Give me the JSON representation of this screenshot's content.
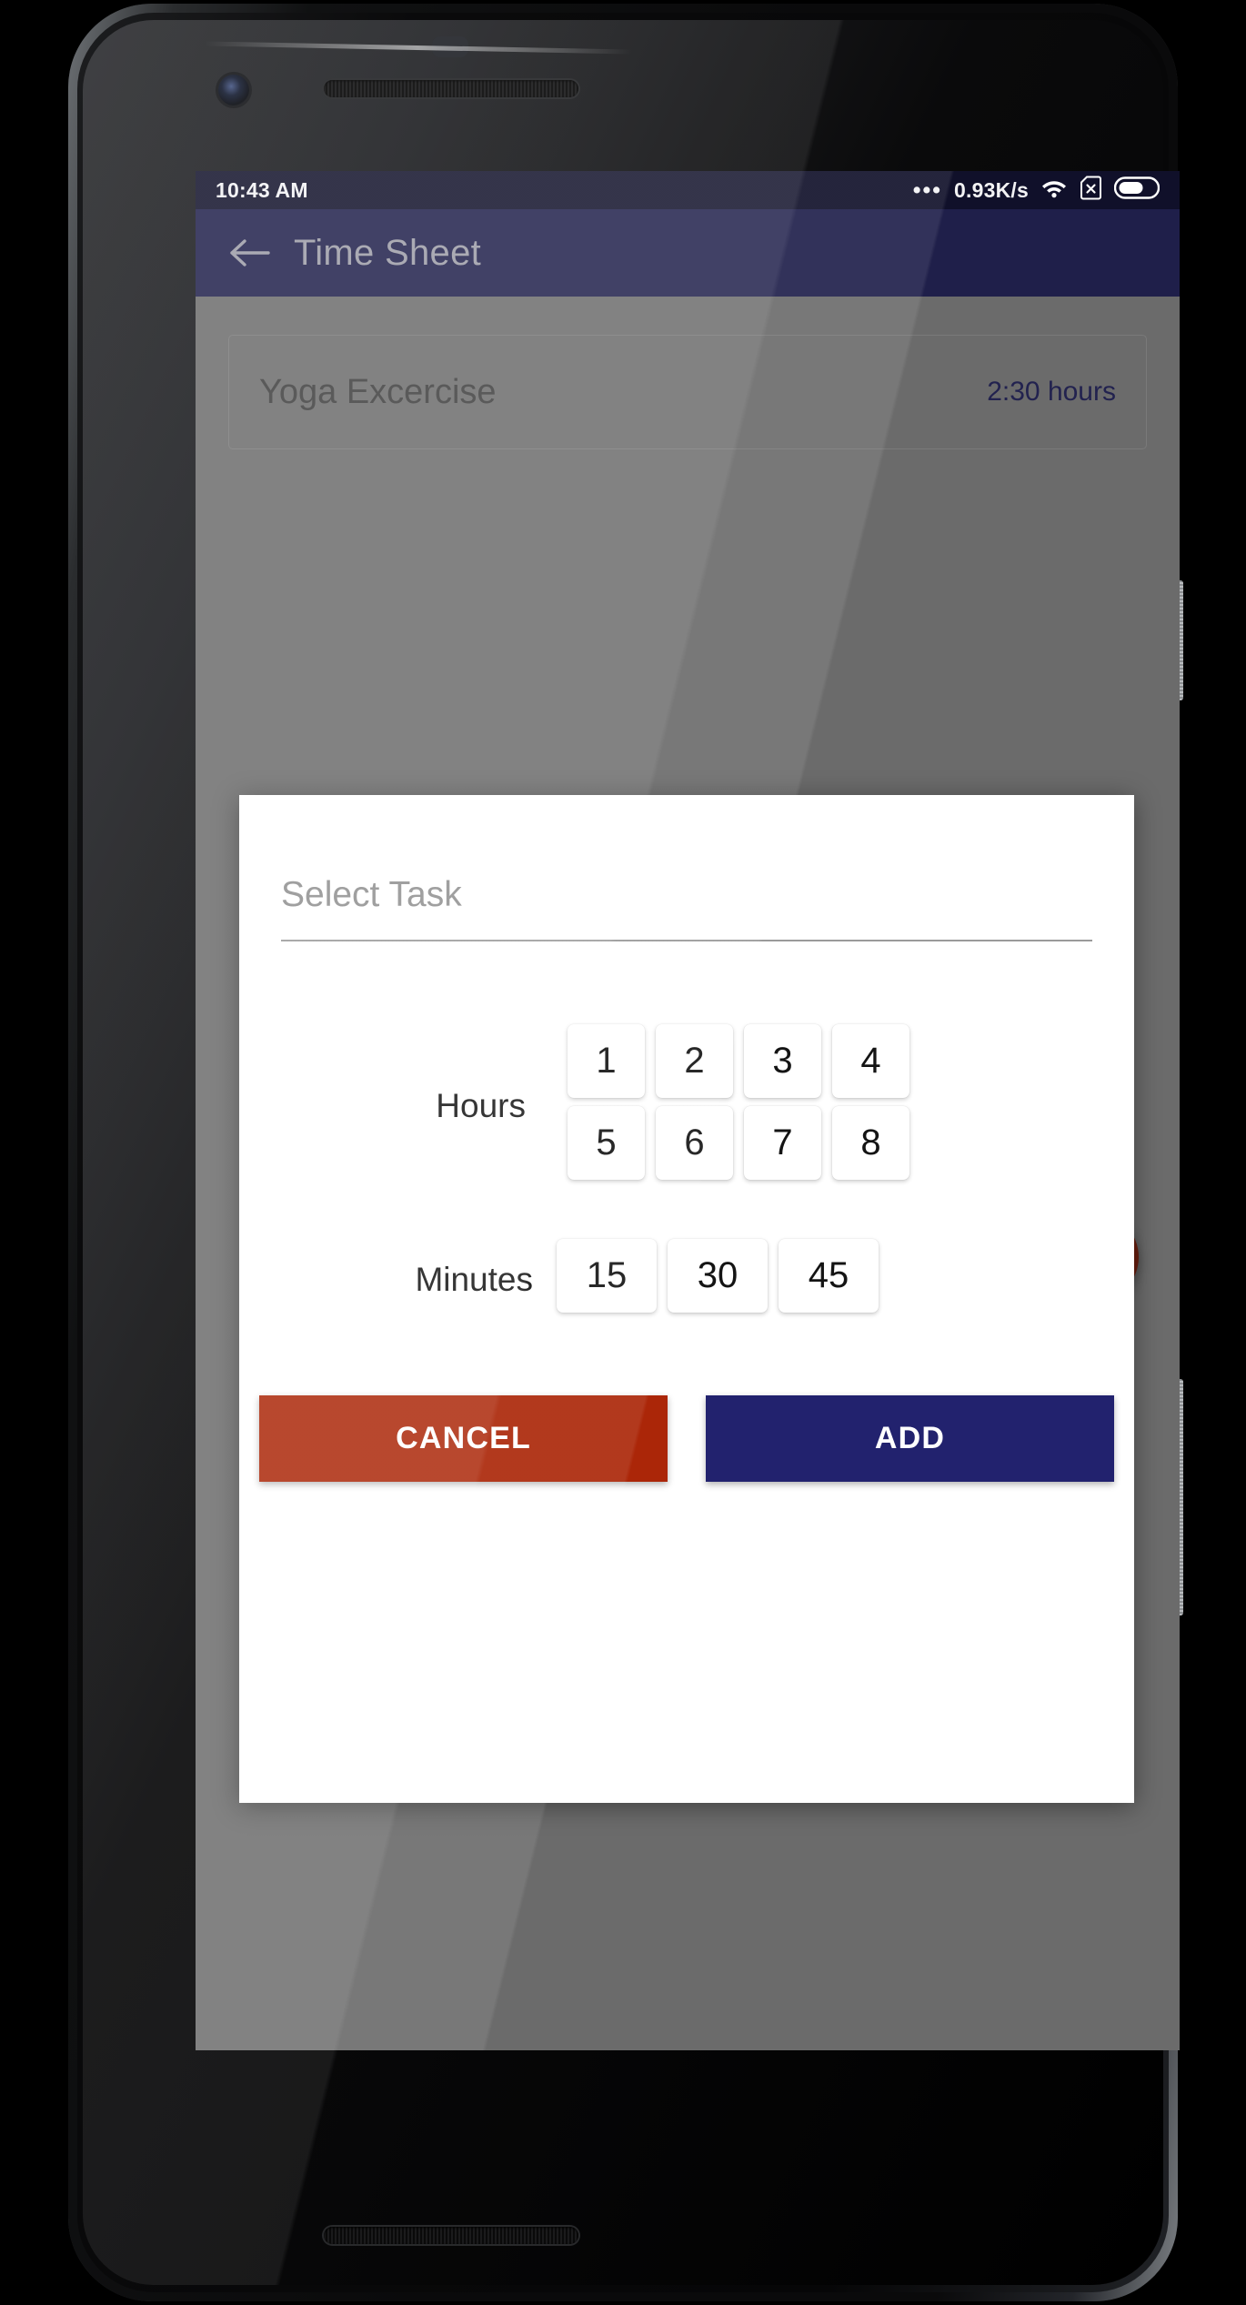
{
  "status_bar": {
    "time": "10:43 AM",
    "dots": "•••",
    "network_speed": "0.93K/s",
    "wifi_icon": "wifi-icon",
    "sim_icon": "sim-card-off-icon",
    "battery_icon": "battery-icon"
  },
  "app_bar": {
    "back_icon": "back-arrow-icon",
    "title": "Time Sheet"
  },
  "content": {
    "task_card": {
      "name": "Yoga Excercise",
      "duration": "2:30 hours"
    },
    "fab": {
      "icon": "plus-icon",
      "label": "+"
    }
  },
  "dialog": {
    "select_task": {
      "placeholder": "Select Task",
      "value": ""
    },
    "hours": {
      "label": "Hours",
      "options": [
        "1",
        "2",
        "3",
        "4",
        "5",
        "6",
        "7",
        "8"
      ]
    },
    "minutes": {
      "label": "Minutes",
      "options": [
        "15",
        "30",
        "45"
      ]
    },
    "actions": {
      "cancel_label": "CANCEL",
      "add_label": "ADD"
    }
  },
  "colors": {
    "status_bar": "#10102a",
    "app_bar": "#1f1f4a",
    "scrim": "#6b6b6b",
    "cancel": "#ab2608",
    "add": "#22226e",
    "fab": "#6a1e0e",
    "duration_text": "#22224f"
  }
}
